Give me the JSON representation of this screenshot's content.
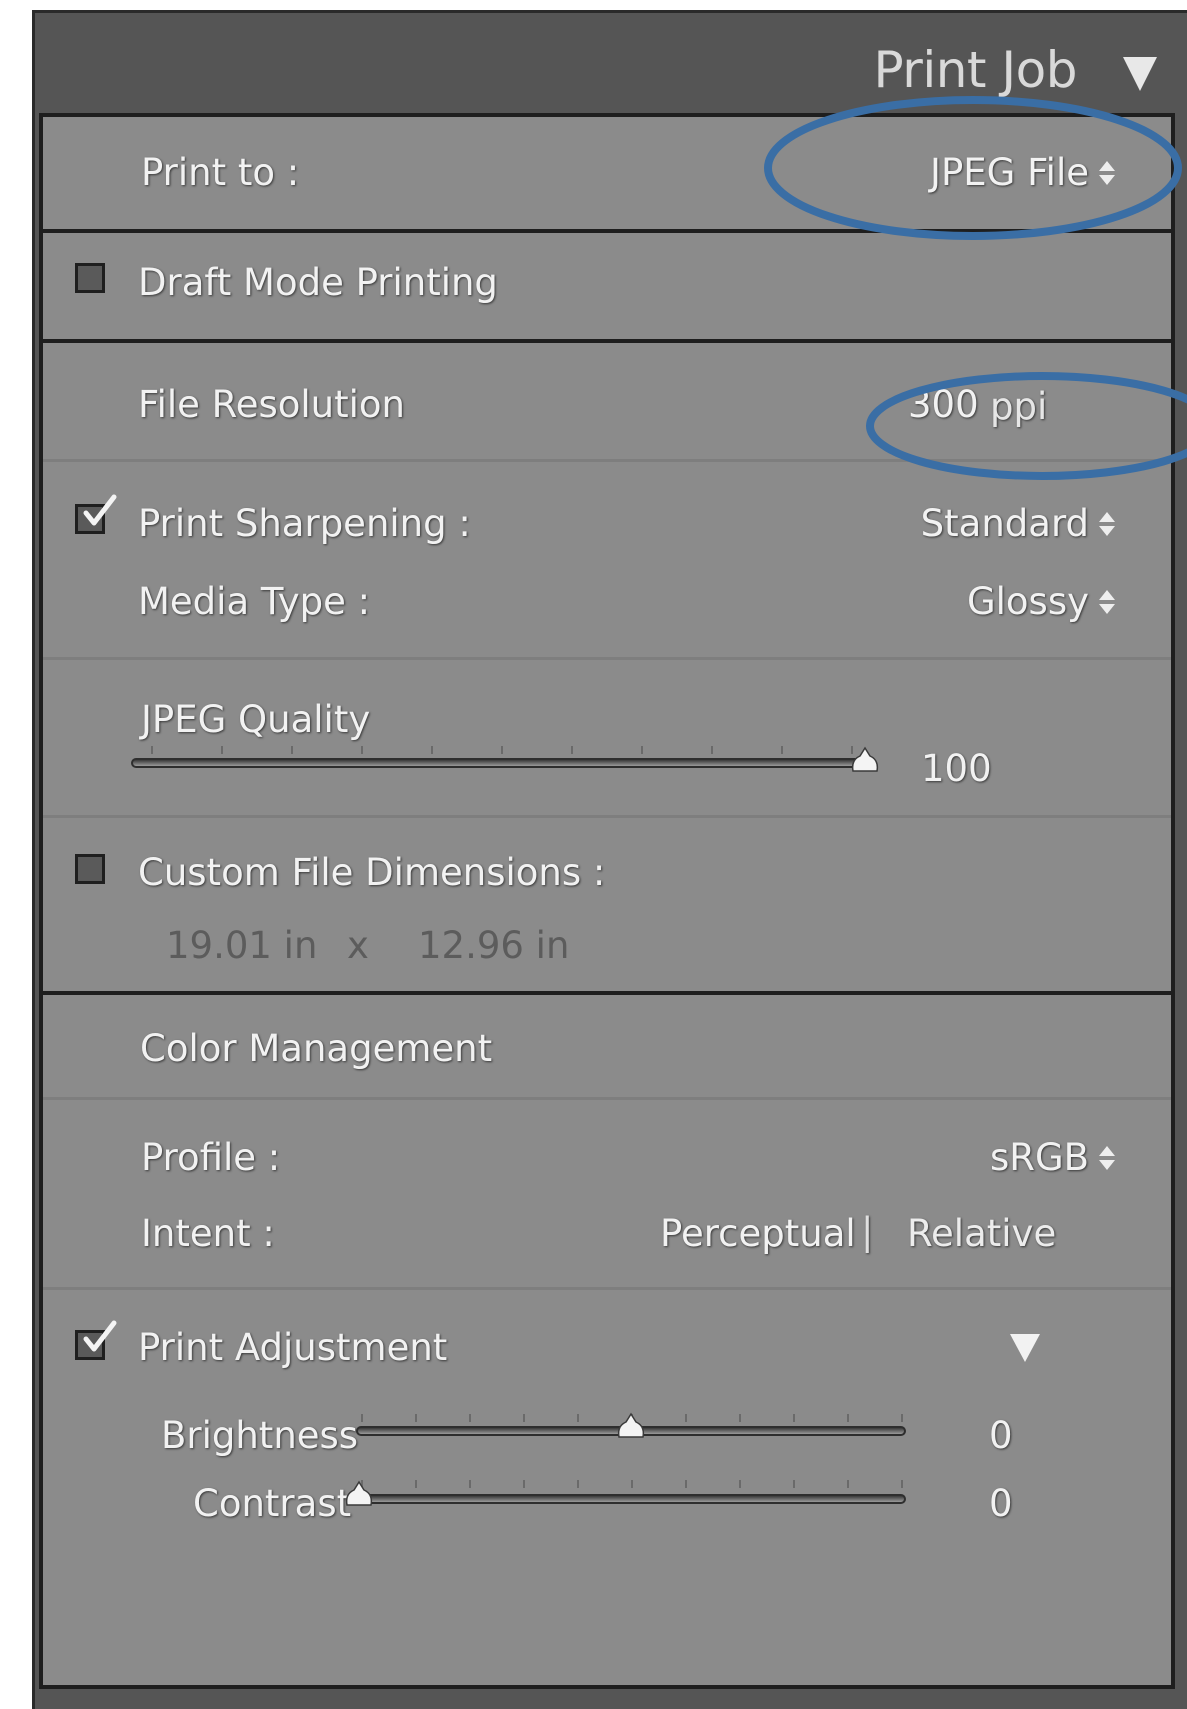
{
  "header": {
    "title": "Print Job",
    "collapse_icon": "triangle-down-icon"
  },
  "print_to": {
    "label": "Print to :",
    "value": "JPEG File"
  },
  "draft_mode": {
    "label": "Draft Mode Printing",
    "checked": false
  },
  "file_resolution": {
    "label": "File Resolution",
    "value": "300",
    "unit": "ppi"
  },
  "print_sharpening": {
    "label": "Print Sharpening :",
    "checked": true,
    "value": "Standard"
  },
  "media_type": {
    "label": "Media Type :",
    "value": "Glossy"
  },
  "jpeg_quality": {
    "label": "JPEG Quality",
    "value": "100",
    "level": 1.0
  },
  "custom_dimensions": {
    "label": "Custom File Dimensions :",
    "checked": false,
    "width": "19.01 in",
    "separator": "x",
    "height": "12.96 in"
  },
  "color_management": {
    "label": "Color Management",
    "profile_label": "Profile :",
    "profile_value": "sRGB",
    "intent_label": "Intent :",
    "intent_perceptual": "Perceptual",
    "intent_divider": "|",
    "intent_relative": "Relative"
  },
  "print_adjustment": {
    "label": "Print Adjustment",
    "checked": true,
    "brightness_label": "Brightness",
    "brightness_value": "0",
    "brightness_level": 0.5,
    "contrast_label": "Contrast",
    "contrast_value": "0",
    "contrast_level": 0.0
  },
  "colors": {
    "panel_dark": "#555555",
    "panel_body": "#8b8b8b",
    "text": "#f2f2f2",
    "annotation": "#3a6ea5"
  }
}
